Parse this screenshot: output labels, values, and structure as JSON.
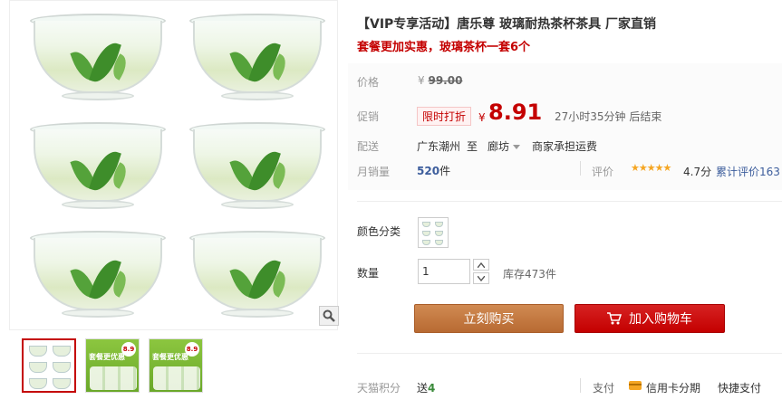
{
  "product": {
    "title": "【VIP专享活动】唐乐尊 玻璃耐热茶杯茶具 厂家直销",
    "subtitle": "套餐更加实惠，玻璃茶杯一套6个"
  },
  "thumbnails": {
    "promo_title": "套餐更优惠",
    "promo_badge": "8.9"
  },
  "price": {
    "label": "价格",
    "currency": "¥",
    "original": "99.00"
  },
  "promo": {
    "label": "促销",
    "badge": "限时打折",
    "currency": "¥",
    "sale_price": "8.91",
    "countdown": "27小时35分钟 后结束"
  },
  "shipping": {
    "label": "配送",
    "from": "广东潮州",
    "to_word": "至",
    "to": "廊坊",
    "note": "商家承担运费"
  },
  "sales": {
    "label": "月销量",
    "count": "520",
    "unit": "件",
    "rating_label": "评价",
    "stars": "★★★★★",
    "rating": "4.7分",
    "reviews": "累计评价163"
  },
  "options": {
    "color_label": "颜色分类",
    "qty_label": "数量",
    "qty_value": "1",
    "stock": "库存473件"
  },
  "actions": {
    "buy": "立刻购买",
    "cart": "加入购物车"
  },
  "footer": {
    "points_label": "天猫积分",
    "points_prefix": "送",
    "points_value": "4",
    "pay_label": "支付",
    "credit": "信用卡分期",
    "quick": "快捷支付"
  },
  "colors": {
    "accent": "#c40000",
    "buy_button": "#c07a44",
    "link": "#3c5d9c"
  }
}
